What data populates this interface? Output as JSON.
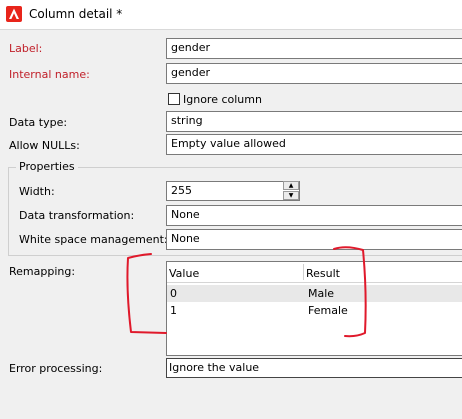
{
  "window": {
    "title": "Column detail *"
  },
  "labels": {
    "label": "Label:",
    "internal_name": "Internal name:",
    "ignore_column": "Ignore column",
    "data_type": "Data type:",
    "allow_nulls": "Allow NULLs:",
    "properties": "Properties",
    "width": "Width:",
    "data_transformation": "Data transformation:",
    "white_space": "White space management:",
    "remapping": "Remapping:",
    "error_processing": "Error processing:"
  },
  "values": {
    "label": "gender",
    "internal_name": "gender",
    "ignore_column_checked": false,
    "data_type": "string",
    "allow_nulls": "Empty value allowed",
    "width": "255",
    "data_transformation": "None",
    "white_space": "None",
    "error_processing": "Ignore the value"
  },
  "remapping": {
    "columns": [
      "Value",
      "Result"
    ],
    "rows": [
      {
        "value": "0",
        "result": "Male"
      },
      {
        "value": "1",
        "result": "Female"
      }
    ]
  },
  "colors": {
    "required_label": "#c0202a",
    "annotation": "#e0192b",
    "app_icon": "#e8251b"
  }
}
